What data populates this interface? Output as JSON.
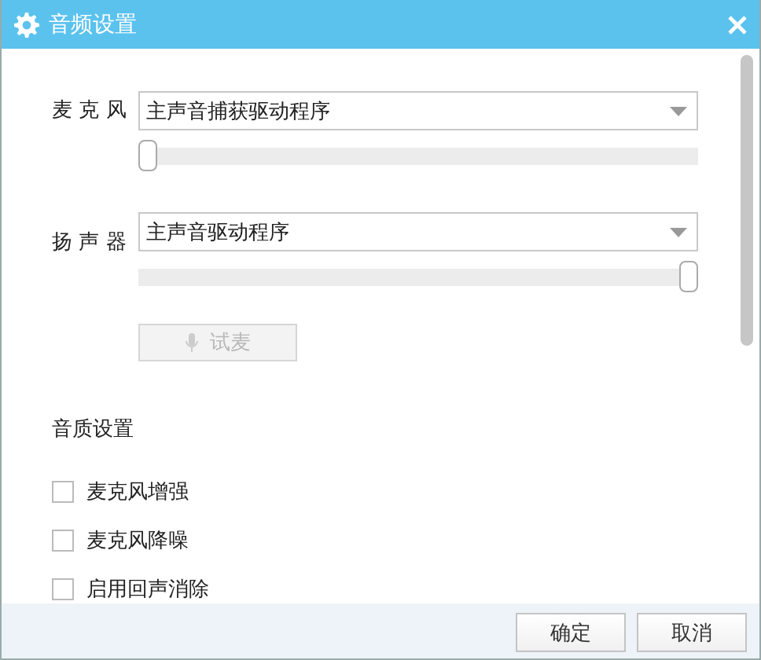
{
  "window": {
    "title": "音频设置"
  },
  "devices": [
    {
      "label": "麦 克 风",
      "value": "主声音捕获驱动程序",
      "level": 0
    },
    {
      "label": "扬 声 器",
      "value": "主声音驱动程序",
      "level": 1
    }
  ],
  "test_button": {
    "label": "试麦",
    "disabled": true
  },
  "quality": {
    "title": "音质设置",
    "options": [
      {
        "label": "麦克风增强",
        "checked": false
      },
      {
        "label": "麦克风降噪",
        "checked": false
      },
      {
        "label": "启用回声消除",
        "checked": false
      }
    ]
  },
  "buttons": [
    "确定",
    "取消"
  ]
}
